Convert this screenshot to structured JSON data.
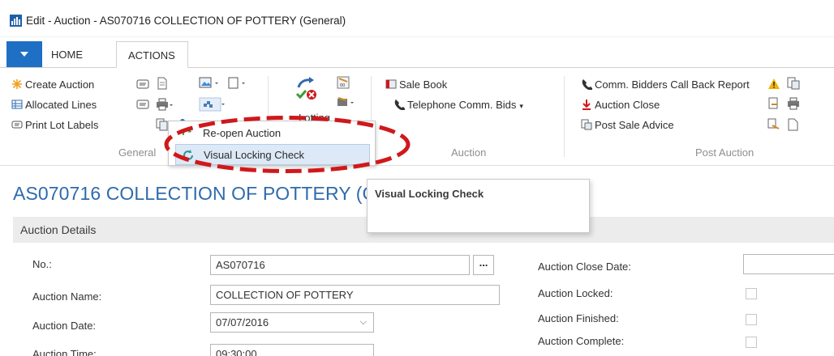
{
  "window": {
    "title": "Edit - Auction - AS070716 COLLECTION OF POTTERY (General)"
  },
  "tabs": {
    "home": "HOME",
    "actions": "ACTIONS"
  },
  "ribbon": {
    "general": {
      "label": "General",
      "create_auction": "Create Auction",
      "allocated_lines": "Allocated Lines",
      "print_lot_labels": "Print Lot Labels",
      "lottery_partial": "Lotting"
    },
    "auction": {
      "label": "Auction",
      "sale_book": "Sale Book",
      "telephone_comm_bids": "Telephone Comm. Bids"
    },
    "post_auction": {
      "label": "Post Auction",
      "comm_bidders_report": "Comm. Bidders Call Back Report",
      "auction_close": "Auction Close",
      "post_sale_advice": "Post Sale Advice"
    }
  },
  "dropdown_menu": {
    "reopen": "Re-open Auction",
    "visual_locking_check": "Visual Locking Check"
  },
  "tooltip": {
    "title": "Visual Locking Check"
  },
  "page": {
    "title": "AS070716 COLLECTION OF POTTERY (G",
    "section": "Auction Details"
  },
  "form": {
    "no_label": "No.:",
    "no_value": "AS070716",
    "assist_button": "...",
    "name_label": "Auction Name:",
    "name_value": "COLLECTION OF POTTERY",
    "date_label": "Auction Date:",
    "date_value": "07/07/2016",
    "time_label": "Auction Time:",
    "time_value": "09:30:00",
    "close_date_label": "Auction Close Date:",
    "close_date_value": "",
    "locked_label": "Auction Locked:",
    "locked": false,
    "finished_label": "Auction Finished:",
    "finished": false,
    "complete_label": "Auction Complete:",
    "complete": false
  },
  "colors": {
    "accent": "#1f6fc4",
    "title_blue": "#2f6bac",
    "highlight_red": "#d0181b",
    "menu_selected": "#dde9f6"
  }
}
